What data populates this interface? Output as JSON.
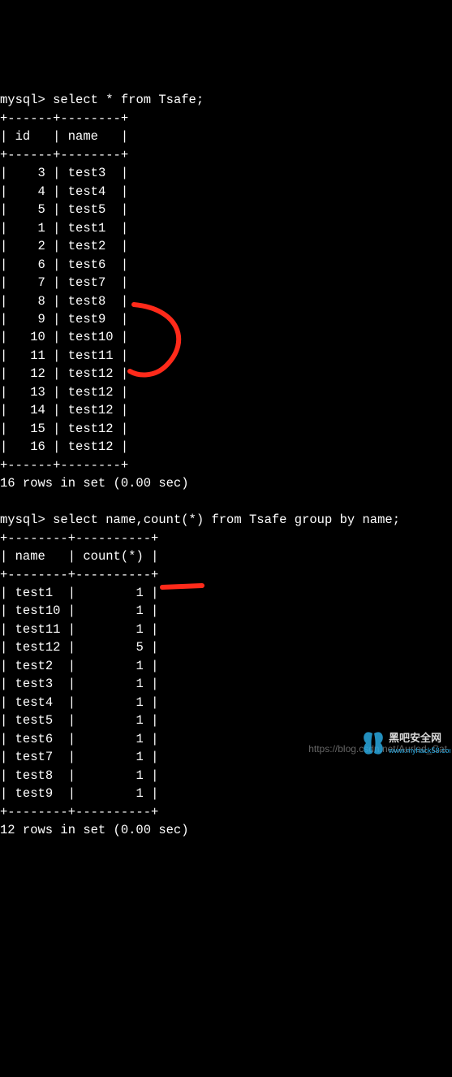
{
  "query1": {
    "prompt": "mysql>",
    "sql": "select * from Tsafe;",
    "columns": [
      "id",
      "name"
    ],
    "rows": [
      {
        "id": "3",
        "name": "test3"
      },
      {
        "id": "4",
        "name": "test4"
      },
      {
        "id": "5",
        "name": "test5"
      },
      {
        "id": "1",
        "name": "test1"
      },
      {
        "id": "2",
        "name": "test2"
      },
      {
        "id": "6",
        "name": "test6"
      },
      {
        "id": "7",
        "name": "test7"
      },
      {
        "id": "8",
        "name": "test8"
      },
      {
        "id": "9",
        "name": "test9"
      },
      {
        "id": "10",
        "name": "test10"
      },
      {
        "id": "11",
        "name": "test11"
      },
      {
        "id": "12",
        "name": "test12"
      },
      {
        "id": "13",
        "name": "test12"
      },
      {
        "id": "14",
        "name": "test12"
      },
      {
        "id": "15",
        "name": "test12"
      },
      {
        "id": "16",
        "name": "test12"
      }
    ],
    "status": "16 rows in set (0.00 sec)"
  },
  "query2": {
    "prompt": "mysql>",
    "sql": "select name,count(*) from Tsafe group by name;",
    "columns": [
      "name",
      "count(*)"
    ],
    "rows": [
      {
        "name": "test1",
        "count": "1"
      },
      {
        "name": "test10",
        "count": "1"
      },
      {
        "name": "test11",
        "count": "1"
      },
      {
        "name": "test12",
        "count": "5"
      },
      {
        "name": "test2",
        "count": "1"
      },
      {
        "name": "test3",
        "count": "1"
      },
      {
        "name": "test4",
        "count": "1"
      },
      {
        "name": "test5",
        "count": "1"
      },
      {
        "name": "test6",
        "count": "1"
      },
      {
        "name": "test7",
        "count": "1"
      },
      {
        "name": "test8",
        "count": "1"
      },
      {
        "name": "test9",
        "count": "1"
      }
    ],
    "status": "12 rows in set (0.00 sec)"
  },
  "watermark": "https://blog.csdn.net/Aurled_Cat"
}
